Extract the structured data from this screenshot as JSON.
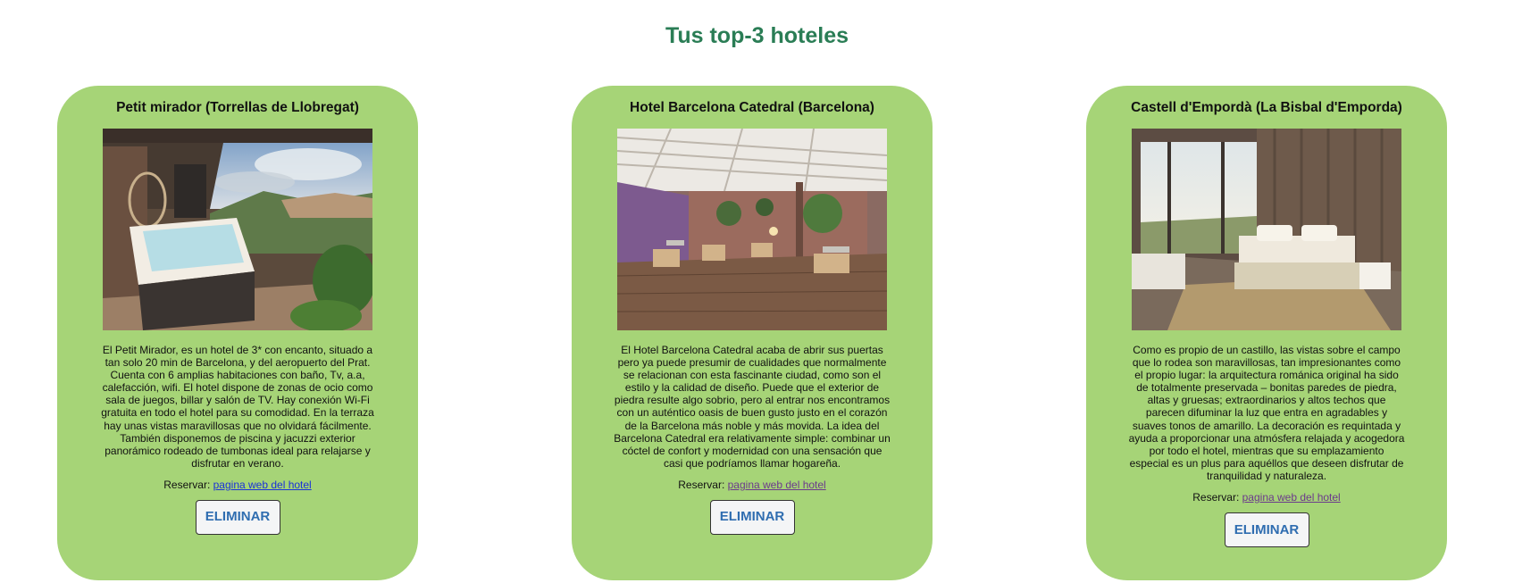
{
  "page": {
    "title": "Tus top-3 hoteles"
  },
  "hotels": [
    {
      "name": "Petit mirador (Torrellas de Llobregat)",
      "description": "El Petit Mirador, es un hotel de 3* con encanto, situado a tan solo 20 min de Barcelona, y del aeropuerto del Prat. Cuenta con 6 amplias habitaciones con baño, Tv, a.a, calefacción, wifi. El hotel dispone de zonas de ocio como sala de juegos, billar y salón de TV. Hay conexión Wi-Fi gratuita en todo el hotel para su comodidad. En la terraza hay unas vistas maravillosas que no olvidará fácilmente. También disponemos de piscina y jacuzzi exterior panorámico rodeado de tumbonas ideal para relajarse y disfrutar en verano.",
      "reserve_label": "Reservar:",
      "link_label": "pagina web del hotel",
      "delete_label": "ELIMINAR",
      "photo": "hotel-terrace-jacuzzi-photo"
    },
    {
      "name": "Hotel Barcelona Catedral (Barcelona)",
      "description": "El Hotel Barcelona Catedral acaba de abrir sus puertas pero ya puede presumir de cualidades que normalmente se relacionan con esta fascinante ciudad, como son el estilo y la calidad de diseño. Puede que el exterior de piedra resulte algo sobrio, pero al entrar nos encontramos con un auténtico oasis de buen gusto justo en el corazón de la Barcelona más noble y más movida. La idea del Barcelona Catedral era relativamente simple: combinar un cóctel de confort y modernidad con una sensación que casi que podríamos llamar hogareña.",
      "reserve_label": "Reservar:",
      "link_label": "pagina web del hotel",
      "delete_label": "ELIMINAR",
      "photo": "hotel-rooftop-terrace-photo"
    },
    {
      "name": "Castell d'Empordà (La Bisbal d'Emporda)",
      "description": "Como es propio de un castillo, las vistas sobre el campo que lo rodea son maravillosas, tan impresionantes como el propio lugar: la arquitectura románica original ha sido de totalmente preservada – bonitas paredes de piedra, altas y gruesas; extraordinarios y altos techos que parecen difuminar la luz que entra en agradables y suaves tonos de amarillo. La decoración es requintada y ayuda a proporcionar una atmósfera relajada y acogedora por todo el hotel, mientras que su emplazamiento especial es un plus para aquéllos que deseen disfrutar de tranquilidad y naturaleza.",
      "reserve_label": "Reservar:",
      "link_label": "pagina web del hotel",
      "delete_label": "ELIMINAR",
      "photo": "hotel-bedroom-view-photo"
    }
  ],
  "colors": {
    "title": "#2a7d55",
    "card_bg": "#a6d477",
    "link": "#1a32d8",
    "link_visited": "#6b3a8c",
    "button_text": "#2f6db0"
  }
}
